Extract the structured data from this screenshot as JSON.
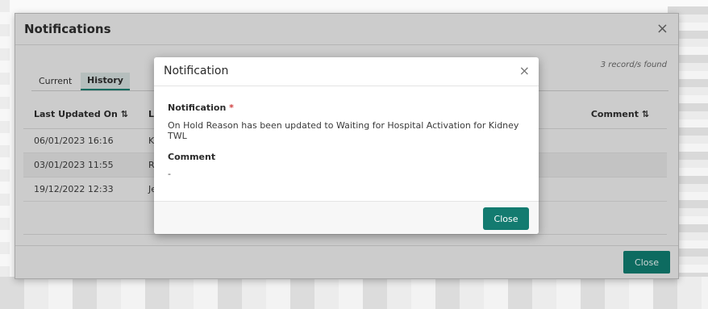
{
  "outer": {
    "title": "Notifications",
    "close_icon": "×",
    "records_found": "3 record/s found",
    "tabs": [
      {
        "label": "Current"
      },
      {
        "label": "History"
      }
    ],
    "table": {
      "headers": {
        "last_updated": "Last Updated On ⇅",
        "second_col_partial": "La",
        "comment": "Comment ⇅"
      },
      "rows": [
        {
          "date": "06/01/2023 16:16",
          "partial": "Ki"
        },
        {
          "date": "03/01/2023 11:55",
          "partial": "Ri"
        },
        {
          "date": "19/12/2022 12:33",
          "partial": "Je"
        }
      ]
    },
    "close_label": "Close",
    "accent_color": "#0f7a6e"
  },
  "inner": {
    "title": "Notification",
    "close_icon": "×",
    "notification_label": "Notification",
    "required_marker": "*",
    "notification_value": "On Hold Reason has been updated to Waiting for Hospital Activation for Kidney TWL",
    "comment_label": "Comment",
    "comment_value": "-",
    "close_label": "Close"
  }
}
